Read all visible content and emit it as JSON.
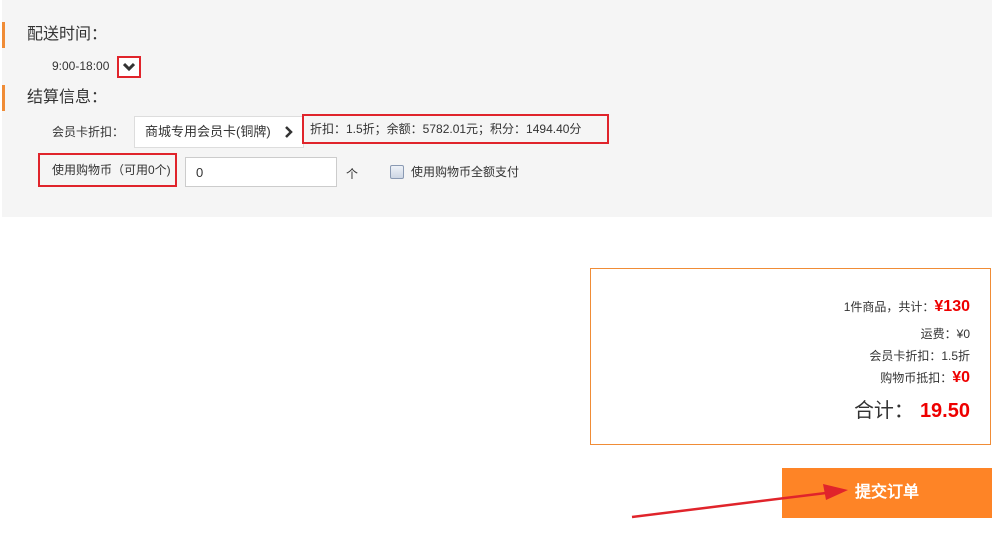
{
  "delivery": {
    "title": "配送时间：",
    "time_value": "9:00-18:00"
  },
  "settlement": {
    "title": "结算信息：",
    "card_label": "会员卡折扣：",
    "card_selected": "商城专用会员卡(铜牌)",
    "card_info": "折扣：1.5折；余额：5782.01元；积分：1494.40分",
    "coin_label": "使用购物币（可用0个)",
    "coin_value": "0",
    "coin_unit": "个",
    "full_pay_label": "使用购物币全额支付"
  },
  "summary": {
    "items_label": "1件商品，共计：",
    "items_total": "¥130",
    "shipping": "运费：¥0",
    "card_discount": "会员卡折扣：1.5折",
    "coin_deduct_label": "购物币抵扣：",
    "coin_deduct_value": "¥0",
    "total_label": "合计：",
    "total_value": "19.50"
  },
  "actions": {
    "submit_label": "提交订单"
  },
  "colors": {
    "accent": "#fe8426",
    "highlight": "#e0242b",
    "price": "#ee0000"
  }
}
